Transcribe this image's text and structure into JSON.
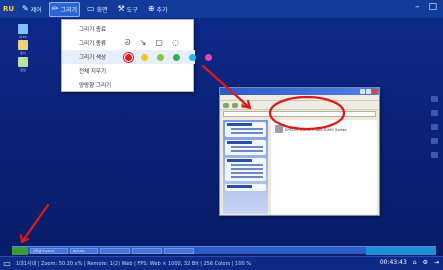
{
  "toolbar": {
    "logo": "RU",
    "items": [
      {
        "icon": "✎",
        "label": "제어"
      },
      {
        "icon": "✏",
        "label": "그리기"
      },
      {
        "icon": "▭",
        "label": "화면"
      },
      {
        "icon": "⚒",
        "label": "도구"
      },
      {
        "icon": "⊕",
        "label": "추가"
      }
    ],
    "window_controls": {
      "minimize": "–",
      "close": "□"
    }
  },
  "desktop_icons": [
    {
      "label": "내 PC"
    },
    {
      "label": "문서"
    },
    {
      "label": "편집"
    }
  ],
  "draw_menu": {
    "end_label": "그리기 종료",
    "kind_label": "그리기 종류",
    "kind_tools": [
      "pen-icon",
      "arrow-icon",
      "rectangle-icon",
      "circle-icon"
    ],
    "color_label": "그리기 색상",
    "colors": [
      "#e21f26",
      "#f5c518",
      "#8cc63f",
      "#2ab34a",
      "#29b6e6",
      "#e646b8"
    ],
    "selected_color_index": 0,
    "clear_label": "전체 지우기",
    "free_draw_label": "양방향 그리기"
  },
  "remote_window": {
    "file_label": "EPSON Stylus Photo R390 Series"
  },
  "annotation_color": "#e01818",
  "remote_taskbar": {
    "tasks": [
      "인터넷 Explorer",
      "Remote"
    ]
  },
  "status_bar": {
    "text": "1대1사내 | Zoom: 50.20 x% | Remote: 1(2) Web | FPS: Web × 1000, 32 Bit | 256 Colors | 100 %",
    "time": "00:43:43",
    "icons": [
      "home-icon",
      "settings-icon",
      "exit-icon"
    ]
  }
}
